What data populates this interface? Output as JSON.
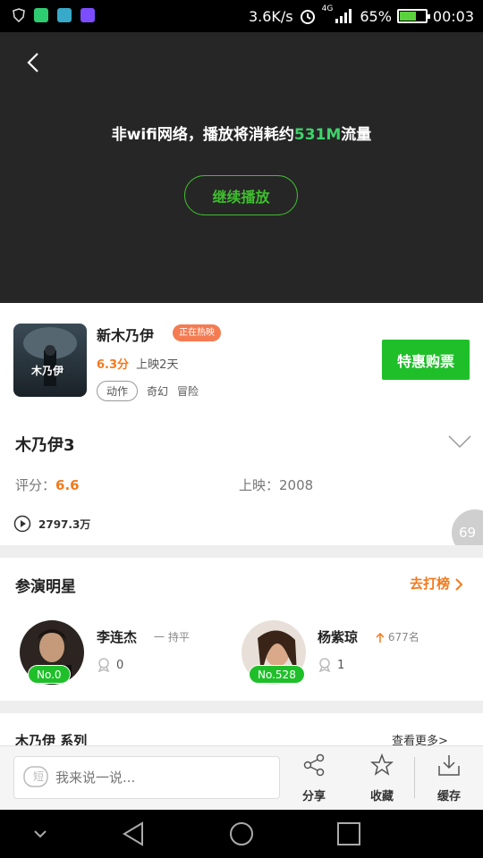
{
  "status_bar": {
    "speed": "3.6K/s",
    "network": "4G",
    "battery_pct": "65%",
    "battery_level": 0.65,
    "time": "00:03",
    "colors": {
      "app1": "#2ecc71",
      "app2": "#38a9c8",
      "app3": "#7c4dff"
    }
  },
  "video": {
    "warning_prefix": "非wifi网络，播放将消耗约",
    "warning_amount": "531M",
    "warning_suffix": "流量",
    "continue_label": "继续播放"
  },
  "movie": {
    "title": "新木乃伊",
    "badge": "正在热映",
    "score": "6.3分",
    "released": "上映2天",
    "tags": [
      "动作",
      "奇幻",
      "冒险"
    ],
    "buy_label": "特惠购票",
    "poster_text": "木乃伊"
  },
  "series": {
    "title": "木乃伊3",
    "rating_label": "评分：",
    "rating_value": "6.6",
    "release_label": "上映：",
    "release_year": "2008",
    "plays": "2797.3万",
    "float_badge": "69"
  },
  "cast": {
    "title": "参演明星",
    "rank_link": "去打榜",
    "actors": [
      {
        "name": "李连杰",
        "role": "一 持平",
        "rank": "No.0",
        "likes": "0"
      },
      {
        "name": "杨紫琼",
        "trend": "677名",
        "rank": "No.528",
        "likes": "1"
      }
    ]
  },
  "series_section": {
    "title": "木乃伊 系列",
    "more": "查看更多>"
  },
  "toolbar": {
    "comment_placeholder": "我来说一说...",
    "comment_icon": "短",
    "share": "分享",
    "favorite": "收藏",
    "cache": "缓存"
  },
  "accent_colors": {
    "green": "#1fbf2a",
    "orange": "#f27a1e",
    "badge": "#f47b52"
  }
}
